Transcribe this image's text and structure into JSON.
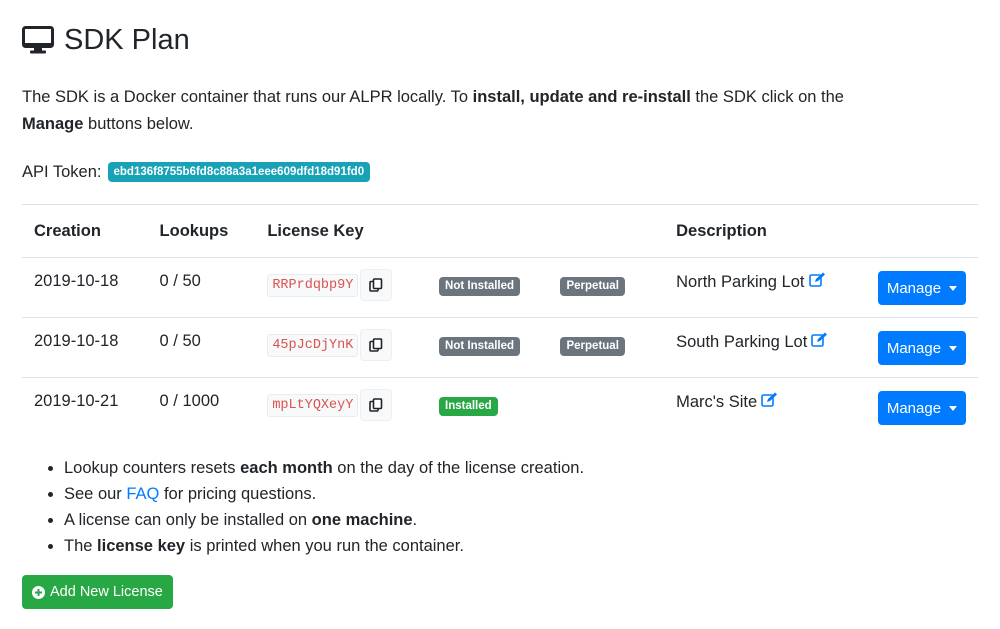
{
  "header": {
    "title": "SDK Plan",
    "icon": "desktop-icon"
  },
  "intro": {
    "p1": "The SDK is a Docker container that runs our ALPR locally. To ",
    "b1": "install, update and re-install",
    "p2": " the SDK click on the ",
    "b2": "Manage",
    "p3": " buttons below."
  },
  "token": {
    "label": "API Token:",
    "value": "ebd136f8755b6fd8c88a3a1eee609dfd18d91fd0",
    "color": "#17a2b8"
  },
  "table": {
    "headers": {
      "creation": "Creation",
      "lookups": "Lookups",
      "license_key": "License Key",
      "description": "Description"
    },
    "rows": [
      {
        "creation": "2019-10-18",
        "lookups": "0 / 50",
        "license_key": "RRPrdqbp9Y",
        "status": "Not Installed",
        "type": "Perpetual",
        "description": "North Parking Lot",
        "manage": "Manage"
      },
      {
        "creation": "2019-10-18",
        "lookups": "0 / 50",
        "license_key": "45pJcDjYnK",
        "status": "Not Installed",
        "type": "Perpetual",
        "description": "South Parking Lot",
        "manage": "Manage"
      },
      {
        "creation": "2019-10-21",
        "lookups": "0 / 1000",
        "license_key": "mpLtYQXeyY",
        "status": "Installed",
        "type": "",
        "description": "Marc's Site",
        "manage": "Manage"
      }
    ]
  },
  "notes": {
    "n1a": "Lookup counters resets ",
    "n1b": "each month",
    "n1c": " on the day of the license creation.",
    "n2a": "See our ",
    "n2link": "FAQ",
    "n2c": " for pricing questions.",
    "n3a": "A license can only be installed on ",
    "n3b": "one machine",
    "n3c": ".",
    "n4a": "The ",
    "n4b": "license key",
    "n4c": " is printed when you run the container."
  },
  "add_button": {
    "label": "Add New License",
    "icon": "plus-circle-icon"
  },
  "colors": {
    "primary": "#007bff",
    "success": "#28a745",
    "secondary": "#6c757d",
    "info": "#17a2b8",
    "code": "#d9534f"
  }
}
